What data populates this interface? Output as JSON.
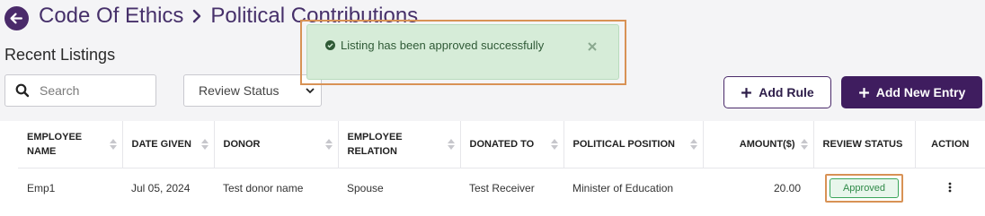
{
  "header": {
    "crumb_parent": "Code Of Ethics",
    "crumb_current": "Political Contributions"
  },
  "section_title": "Recent Listings",
  "search": {
    "placeholder": "Search"
  },
  "filter": {
    "selected": "Review Status"
  },
  "buttons": {
    "add_rule": "Add Rule",
    "add_entry": "Add New Entry"
  },
  "toast": {
    "message": "Listing has been approved successfully"
  },
  "table": {
    "columns": [
      "Employee Name",
      "Date Given",
      "Donor",
      "Employee Relation",
      "Donated To",
      "Political Position",
      "Amount($)",
      "Review Status",
      "Action"
    ],
    "rows": [
      {
        "employee_name": "Emp1",
        "date_given": "Jul 05, 2024",
        "donor": "Test donor name",
        "employee_relation": "Spouse",
        "donated_to": "Test Receiver",
        "political_position": "Minister of Education",
        "amount": "20.00",
        "review_status": "Approved"
      }
    ]
  },
  "colors": {
    "brand": "#3f1d5f",
    "success": "#2f8a48",
    "toast_bg": "#d6ecd8",
    "highlight": "#d89255"
  },
  "icons": [
    "back-arrow-icon",
    "chevron-right-icon",
    "search-icon",
    "chevron-down-icon",
    "plus-icon",
    "check-circle-icon",
    "close-icon",
    "sort-icon",
    "kebab-menu-icon"
  ]
}
